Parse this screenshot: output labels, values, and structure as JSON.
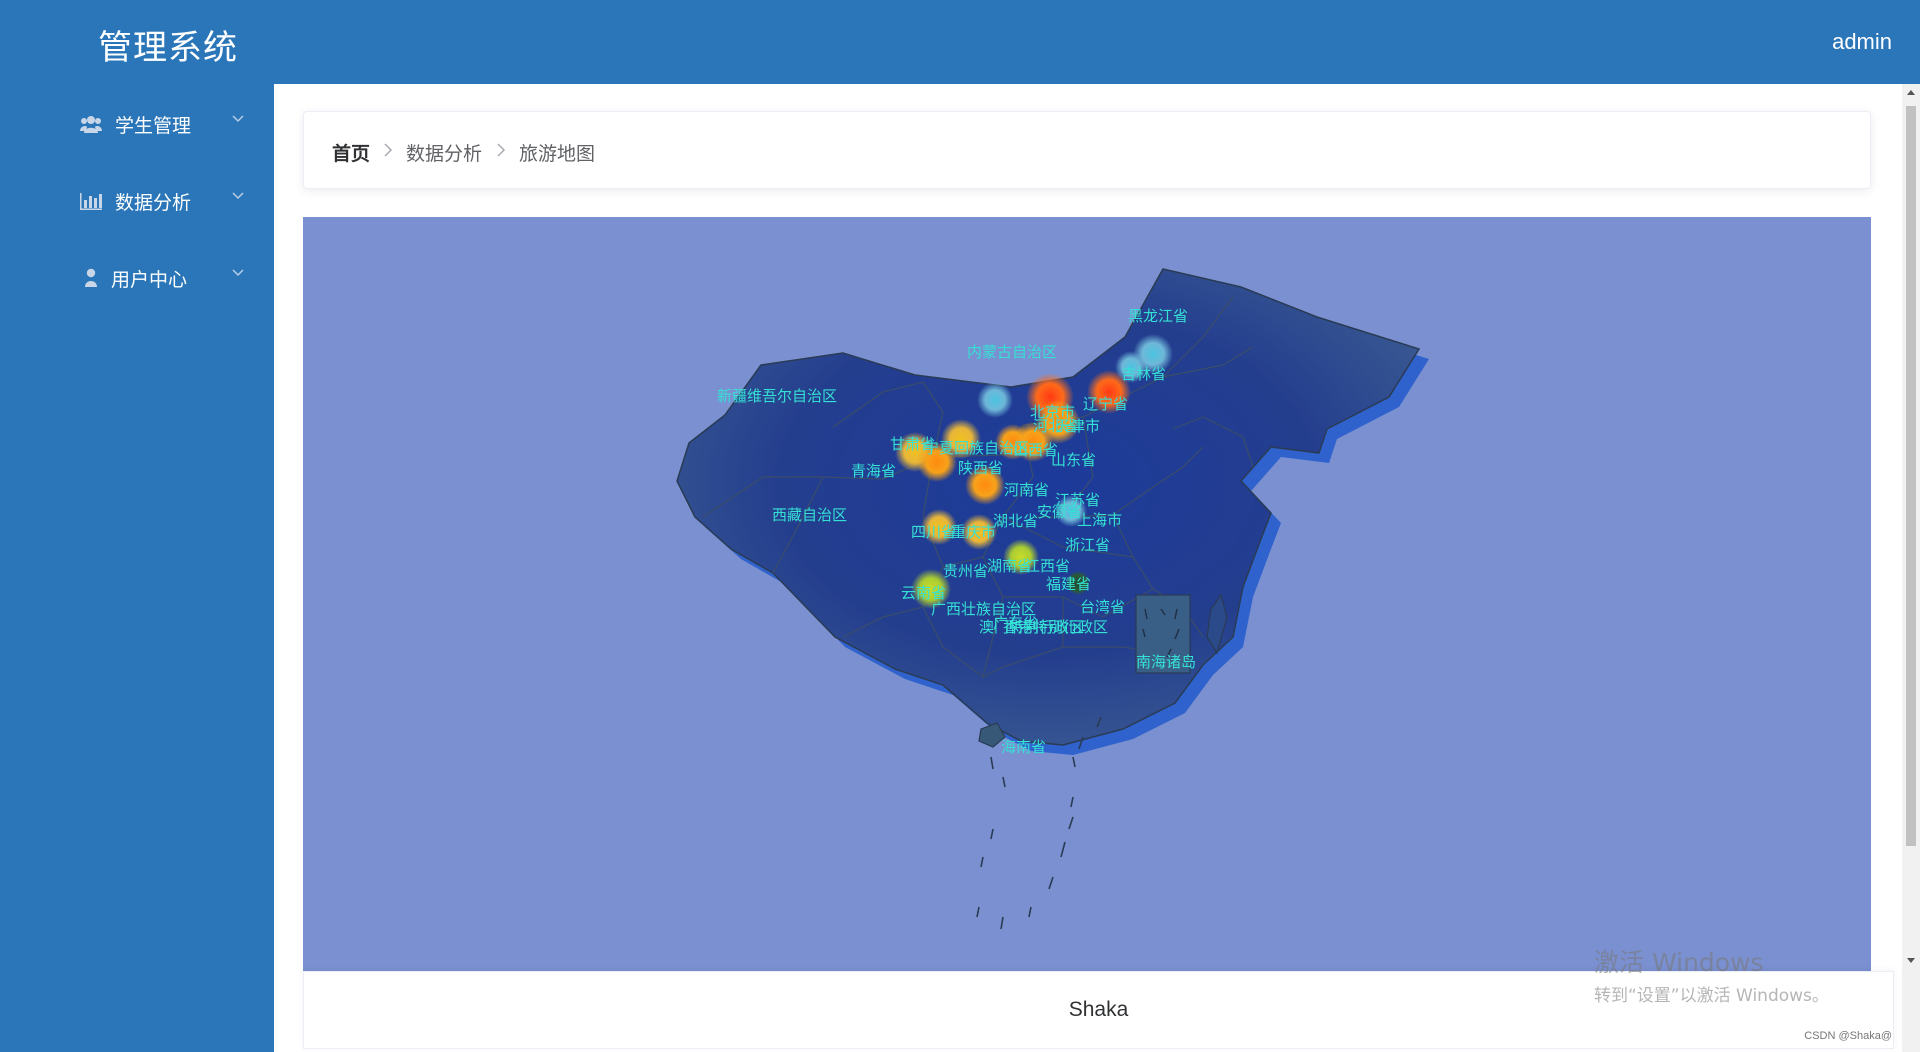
{
  "header": {
    "brand": "管理系统",
    "user": "admin"
  },
  "sidebar": {
    "items": [
      {
        "label": "学生管理",
        "icon": "users-icon"
      },
      {
        "label": "数据分析",
        "icon": "bar-chart-icon"
      },
      {
        "label": "用户中心",
        "icon": "user-icon"
      }
    ]
  },
  "breadcrumb": {
    "items": [
      "首页",
      "数据分析",
      "旅游地图"
    ]
  },
  "map": {
    "background": "#7a90d0",
    "regions": [
      "黑龙江省",
      "吉林省",
      "辽宁省",
      "内蒙古自治区",
      "新疆维吾尔自治区",
      "甘肃省",
      "宁夏回族自治区",
      "青海省",
      "陕西省",
      "山西省",
      "河北省",
      "北京市",
      "天津市",
      "山东省",
      "河南省",
      "江苏省",
      "安徽省",
      "上海市",
      "浙江省",
      "湖北省",
      "湖南省",
      "江西省",
      "福建省",
      "台湾省",
      "四川省",
      "重庆市",
      "贵州省",
      "云南省",
      "广西壮族自治区",
      "广东省",
      "香港特别行政区",
      "澳门特别行政区",
      "西藏自治区",
      "南海诸岛",
      "海南省"
    ]
  },
  "footer": {
    "text": "Shaka"
  },
  "watermark": {
    "line1": "激活 Windows",
    "line2": "转到“设置”以激活 Windows。"
  },
  "credit": "CSDN @Shaka@"
}
